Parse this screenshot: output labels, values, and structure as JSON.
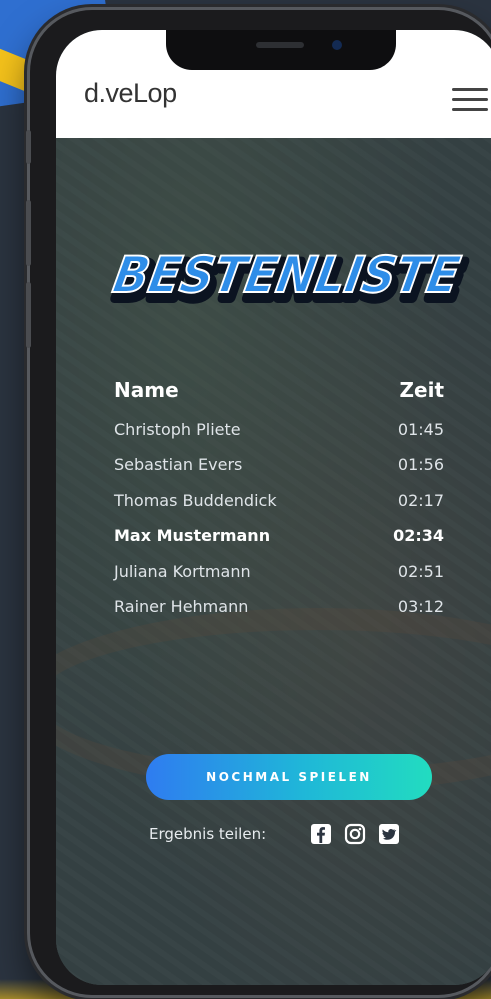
{
  "brand": {
    "logo_text": "d.veLop"
  },
  "header": {
    "menu_icon": "hamburger-menu-icon"
  },
  "title": "BESTENLISTE",
  "leaderboard": {
    "headers": {
      "name": "Name",
      "time": "Zeit"
    },
    "rows": [
      {
        "name": "Christoph Pliete",
        "time": "01:45"
      },
      {
        "name": "Sebastian Evers",
        "time": "01:56"
      },
      {
        "name": "Thomas Buddendick",
        "time": "02:17"
      },
      {
        "name": "Max Mustermann",
        "time": "02:34",
        "highlight": true
      },
      {
        "name": "Juliana Kortmann",
        "time": "02:51"
      },
      {
        "name": "Rainer Hehmann",
        "time": "03:12"
      }
    ]
  },
  "actions": {
    "play_again": "NOCHMAL SPIELEN"
  },
  "share": {
    "label": "Ergebnis teilen:",
    "icons": [
      "facebook-icon",
      "instagram-icon",
      "twitter-icon"
    ]
  },
  "colors": {
    "accent_start": "#2f7cf0",
    "accent_end": "#22dcc0",
    "title_fill": "#2e8de8",
    "header_bg": "#ffffff"
  }
}
